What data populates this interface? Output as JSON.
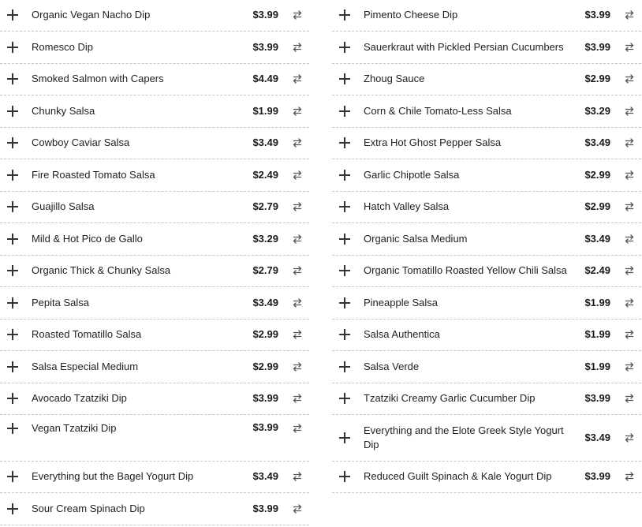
{
  "columns": [
    {
      "items": [
        {
          "name": "Organic Vegan Nacho Dip",
          "price": "$3.99"
        },
        {
          "name": "Romesco Dip",
          "price": "$3.99"
        },
        {
          "name": "Smoked Salmon with Capers",
          "price": "$4.49"
        },
        {
          "name": "Chunky Salsa",
          "price": "$1.99"
        },
        {
          "name": "Cowboy Caviar Salsa",
          "price": "$3.49"
        },
        {
          "name": "Fire Roasted Tomato Salsa",
          "price": "$2.49"
        },
        {
          "name": "Guajillo Salsa",
          "price": "$2.79"
        },
        {
          "name": "Mild & Hot Pico de Gallo",
          "price": "$3.29"
        },
        {
          "name": "Organic Thick & Chunky Salsa",
          "price": "$2.79"
        },
        {
          "name": "Pepita Salsa",
          "price": "$3.49"
        },
        {
          "name": "Roasted Tomatillo Salsa",
          "price": "$2.99"
        },
        {
          "name": "Salsa Especial Medium",
          "price": "$2.99"
        },
        {
          "name": "Avocado Tzatziki Dip",
          "price": "$3.99"
        },
        {
          "name": "Vegan Tzatziki Dip",
          "price": "$3.99"
        },
        {
          "name": "Everything but the Bagel Yogurt Dip",
          "price": "$3.49"
        },
        {
          "name": "Sour Cream Spinach Dip",
          "price": "$3.99"
        }
      ]
    },
    {
      "items": [
        {
          "name": "Pimento Cheese Dip",
          "price": "$3.99"
        },
        {
          "name": "Sauerkraut with Pickled Persian Cucumbers",
          "price": "$3.99"
        },
        {
          "name": "Zhoug Sauce",
          "price": "$2.99"
        },
        {
          "name": "Corn & Chile Tomato-Less Salsa",
          "price": "$3.29"
        },
        {
          "name": "Extra Hot Ghost Pepper Salsa",
          "price": "$3.49"
        },
        {
          "name": "Garlic Chipotle Salsa",
          "price": "$2.99"
        },
        {
          "name": "Hatch Valley Salsa",
          "price": "$2.99"
        },
        {
          "name": "Organic Salsa Medium",
          "price": "$3.49"
        },
        {
          "name": "Organic Tomatillo Roasted Yellow Chili Salsa",
          "price": "$2.49"
        },
        {
          "name": "Pineapple Salsa",
          "price": "$1.99"
        },
        {
          "name": "Salsa Authentica",
          "price": "$1.99"
        },
        {
          "name": "Salsa Verde",
          "price": "$1.99"
        },
        {
          "name": "Tzatziki Creamy Garlic Cucumber Dip",
          "price": "$3.99"
        },
        {
          "name": "Everything and the Elote Greek Style Yogurt Dip",
          "price": "$3.49"
        },
        {
          "name": "Reduced Guilt Spinach & Kale Yogurt Dip",
          "price": "$3.99"
        }
      ]
    }
  ],
  "icons": {
    "add": "plus-icon",
    "swap": "swap-arrows-icon"
  }
}
